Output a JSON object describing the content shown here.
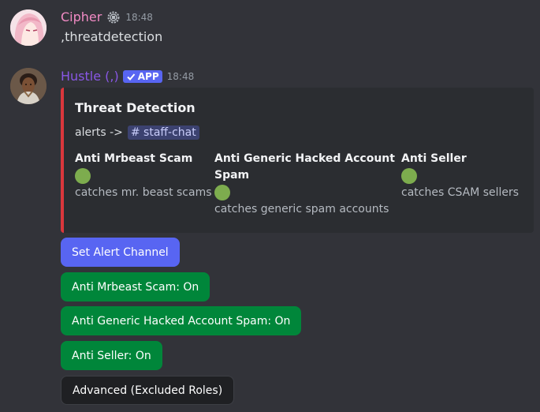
{
  "messages": [
    {
      "username": "Cipher",
      "username_color": "#f28bc5",
      "badge_icon": "bot-gear-icon",
      "timestamp": "18:48",
      "content": ",threatdetection"
    },
    {
      "username": "Hustle (,)",
      "username_color": "#8957e5",
      "app_badge": "APP",
      "app_badge_icon": "checkmark-icon",
      "timestamp": "18:48",
      "embed": {
        "accent_color": "#da373c",
        "title": "Threat Detection",
        "desc_prefix": "alerts ->",
        "channel_mention": "# staff-chat",
        "fields": [
          {
            "name_line1": "Anti Mrbeast Scam",
            "name_line2": "",
            "status_color": "#7dac4e",
            "value": "catches mr. beast scams"
          },
          {
            "name_line1": "Anti Generic Hacked Account",
            "name_line2": "Spam",
            "status_color": "#7dac4e",
            "value": "catches generic spam accounts"
          },
          {
            "name_line1": "Anti Seller",
            "name_line2": "",
            "status_color": "#7dac4e",
            "value": "catches CSAM sellers"
          }
        ]
      },
      "buttons": [
        {
          "label": "Set Alert Channel",
          "style": "primary"
        },
        {
          "label": "Anti Mrbeast Scam: On",
          "style": "success"
        },
        {
          "label": "Anti Generic Hacked Account Spam: On",
          "style": "success"
        },
        {
          "label": "Anti Seller: On",
          "style": "success"
        },
        {
          "label": "Advanced (Excluded Roles)",
          "style": "secondary"
        }
      ]
    }
  ]
}
